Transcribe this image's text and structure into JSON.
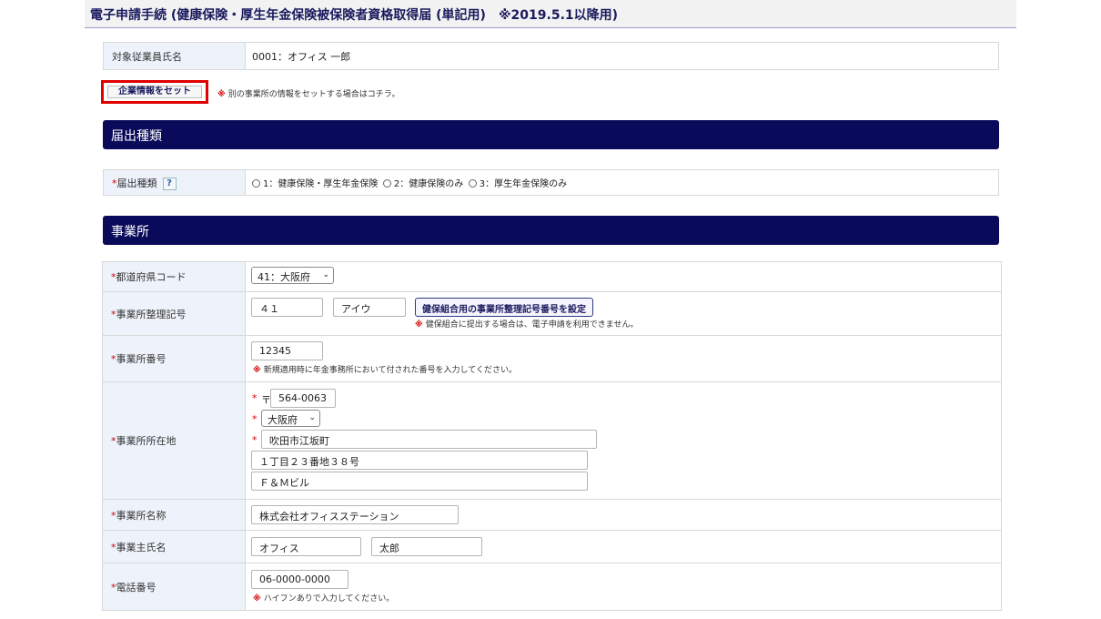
{
  "page": {
    "title": "電子申請手続 (健康保険・厚生年金保険被保険者資格取得届 (単記用)　※2019.5.1以降用)"
  },
  "employee": {
    "label": "対象従業員氏名",
    "value": "0001：オフィス 一郎"
  },
  "company_set": {
    "button_label": "企業情報をセット",
    "note_mark": "※",
    "note": "別の事業所の情報をセットする場合はコチラ。"
  },
  "sections": {
    "notification_type": "届出種類",
    "office": "事業所"
  },
  "notification_type": {
    "required_mark": "*",
    "label": "届出種類",
    "help_label": "?",
    "options": [
      "1：健康保険・厚生年金保険",
      "2：健康保険のみ",
      "3：厚生年金保険のみ"
    ]
  },
  "office": {
    "required_mark": "*",
    "prefecture_code": {
      "label": "都道府県コード",
      "value": "41：大阪府"
    },
    "office_symbol": {
      "label": "事業所整理記号",
      "value1": "４１",
      "value2": "アイウ",
      "button_label": "健保組合用の事業所整理記号番号を設定",
      "note_mark": "※",
      "note": "健保組合に提出する場合は、電子申請を利用できません。"
    },
    "office_number": {
      "label": "事業所番号",
      "value": "12345",
      "note_mark": "※",
      "note": "新規適用時に年金事務所において付された番号を入力してください。"
    },
    "address": {
      "label": "事業所所在地",
      "postal_mark": "〒",
      "postal": "564-0063",
      "prefecture": "大阪府",
      "city": "吹田市江坂町",
      "street": "１丁目２３番地３８号",
      "building": "Ｆ＆Ｍビル"
    },
    "office_name": {
      "label": "事業所名称",
      "value": "株式会社オフィスステーション"
    },
    "owner_name": {
      "label": "事業主氏名",
      "last": "オフィス",
      "first": "太郎"
    },
    "phone": {
      "label": "電話番号",
      "value": "06-0000-0000",
      "note_mark": "※",
      "note": "ハイフンありで入力してください。"
    }
  }
}
